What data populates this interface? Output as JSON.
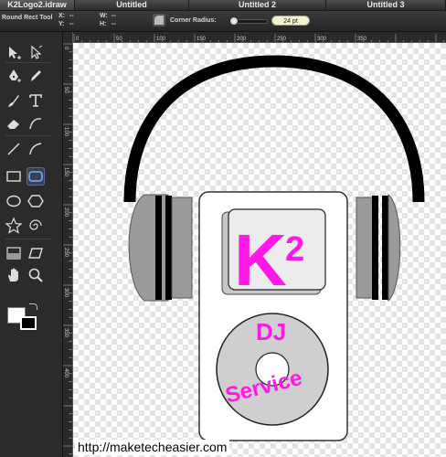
{
  "tabs": [
    {
      "label": "K2Logo2.idraw",
      "active": true
    },
    {
      "label": "Untitled",
      "active": false
    },
    {
      "label": "Untitled 2",
      "active": false
    },
    {
      "label": "Untitled 3",
      "active": false
    }
  ],
  "options": {
    "tool_name": "Round Rect Tool",
    "x_label": "X:",
    "x_value": "--",
    "y_label": "Y:",
    "y_value": "--",
    "w_label": "W:",
    "w_value": "--",
    "h_label": "H:",
    "h_value": "--",
    "corner_label": "Corner Radius:",
    "corner_value": "24 pt"
  },
  "ruler": {
    "top_labels": [
      "0",
      "50",
      "100",
      "150",
      "200",
      "250",
      "300",
      "350"
    ],
    "left_labels": [
      "0",
      "50",
      "100",
      "150",
      "200",
      "250",
      "300",
      "350",
      "400"
    ]
  },
  "artwork": {
    "logo_main": "K",
    "logo_sup": "2",
    "disc_top": "DJ",
    "disc_bottom": "Service",
    "colors": {
      "magenta": "#ff18e8",
      "headband": "#000000",
      "earcup": "#9a9a9a",
      "disc": "#cfcfcf"
    }
  },
  "watermark": "http://maketecheasier.com"
}
